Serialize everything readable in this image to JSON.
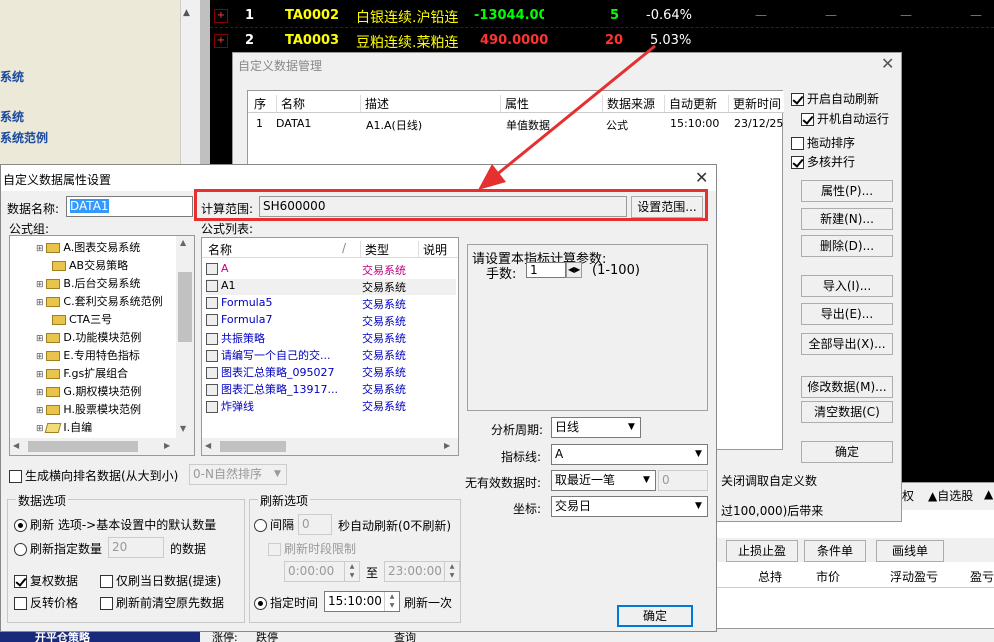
{
  "quotes": [
    {
      "num": "1",
      "code": "TA0002",
      "name": "白银连续.沪铅连",
      "price": "-13044.000",
      "vol": "5",
      "chg": "-0.64%"
    },
    {
      "num": "2",
      "code": "TA0003",
      "name": "豆粕连续.菜粕连",
      "price": "490.0000",
      "vol": "20",
      "chg": "5.03%"
    }
  ],
  "dash": "—",
  "left_panel": [
    "系统",
    "系统",
    "系统范例"
  ],
  "bottom_left": "开平仓策略",
  "mgr": {
    "title": "自定义数据管理",
    "columns": [
      "序",
      "名称",
      "描述",
      "属性",
      "数据来源",
      "自动更新",
      "更新时间"
    ],
    "row": [
      "1",
      "DATA1",
      "A1.A(日线)",
      "单值数据",
      "公式",
      "15:10:00",
      "23/12/25"
    ],
    "checks": [
      {
        "label": "开启自动刷新",
        "on": true
      },
      {
        "label": "开机自动运行",
        "on": true
      },
      {
        "label": "拖动排序",
        "on": false
      },
      {
        "label": "多核并行",
        "on": true
      }
    ],
    "buttons": [
      "属性(P)...",
      "新建(N)...",
      "删除(D)...",
      "导入(I)...",
      "导出(E)...",
      "全部导出(X)...",
      "修改数据(M)...",
      "清空数据(C)",
      "确定"
    ],
    "partial1": "关闭调取自定义数",
    "partial2": "过100,000)后带来"
  },
  "bg_tabs": [
    "权",
    "▲自选股",
    "▲"
  ],
  "bg_buttons": [
    "止损止盈",
    "条件单",
    "画线单"
  ],
  "bg_cols": [
    "总持",
    "市价",
    "浮动盈亏",
    "盈亏"
  ],
  "status": {
    "a": "涨停:",
    "b": "跌停",
    "c": "查询"
  },
  "attr": {
    "title": "自定义数据属性设置",
    "name_label": "数据名称:",
    "name_value": "DATA1",
    "range_label": "计算范围:",
    "range_value": "SH600000",
    "range_btn": "设置范围...",
    "group_label": "公式组:",
    "list_label": "公式列表:",
    "tree": [
      "A.图表交易系统",
      "AB交易策略",
      "B.后台交易系统",
      "C.套利交易系统范例",
      "CTA三号",
      "D.功能模块范例",
      "E.专用特色指标",
      "F.gs扩展组合",
      "G.期权模块范例",
      "H.股票模块范例",
      "I.自编"
    ],
    "list_cols": [
      "名称",
      "/",
      "类型",
      "说明"
    ],
    "list": [
      {
        "name": "A",
        "type": "交易系统",
        "color": "#c00080"
      },
      {
        "name": "A1",
        "type": "交易系统",
        "color": "#000000"
      },
      {
        "name": "Formula5",
        "type": "交易系统",
        "color": "#0000c0"
      },
      {
        "name": "Formula7",
        "type": "交易系统",
        "color": "#0000c0"
      },
      {
        "name": "共振策略",
        "type": "交易系统",
        "color": "#0000c0"
      },
      {
        "name": "请编写一个自己的交...",
        "type": "交易系统",
        "color": "#0000c0"
      },
      {
        "name": "图表汇总策略_095027",
        "type": "交易系统",
        "color": "#0000c0"
      },
      {
        "name": "图表汇总策略_13917...",
        "type": "交易系统",
        "color": "#0000c0"
      },
      {
        "name": "炸弹线",
        "type": "交易系统",
        "color": "#0000c0"
      }
    ],
    "param_title": "请设置本指标计算参数:",
    "param_label": "手数:",
    "param_value": "1",
    "param_range": "(1-100)",
    "period_label": "分析周期:",
    "period_value": "日线",
    "line_label": "指标线:",
    "line_value": "A",
    "invalid_label": "无有效数据时:",
    "invalid_value": "取最近一笔",
    "invalid_num": "0",
    "axis_label": "坐标:",
    "axis_value": "交易日",
    "rank_label": "生成横向排名数据(从大到小)",
    "rank_value": "0-N自然排序",
    "data_group": "数据选项",
    "radio1": "刷新 选项->基本设置中的默认数量",
    "radio2": "刷新指定数量",
    "radio2_val": "20",
    "radio2_suffix": "的数据",
    "chk_fq": "复权数据",
    "chk_today": "仅刷当日数据(提速)",
    "chk_rev": "反转价格",
    "chk_clear": "刷新前清空原先数据",
    "refresh_group": "刷新选项",
    "interval_label": "间隔",
    "interval_val": "0",
    "interval_suffix": "秒自动刷新(0不刷新)",
    "limit_label": "刷新时段限制",
    "time_from": "0:00:00",
    "time_to_label": "至",
    "time_to": "23:00:00",
    "fixed_label": "指定时间",
    "fixed_time": "15:10:00",
    "fixed_suffix": "刷新一次",
    "ok": "确定"
  }
}
